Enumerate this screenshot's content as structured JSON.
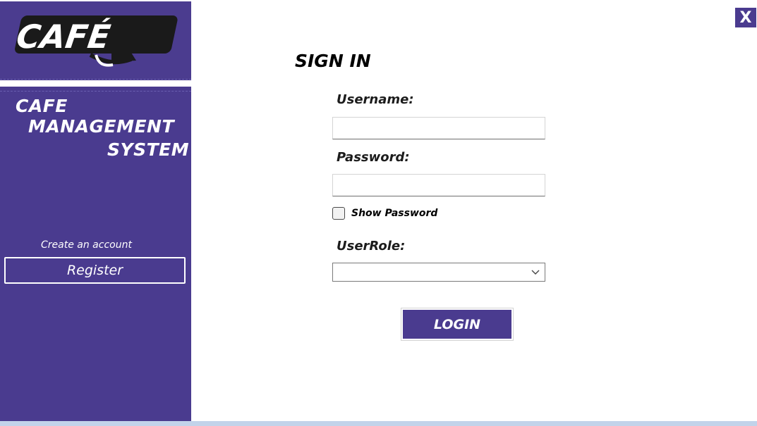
{
  "sidebar": {
    "logo_text": "CAFÉ",
    "title_lines": [
      "CAFE",
      "MANAGEMENT",
      "SYSTEM"
    ],
    "create_account_text": "Create an account",
    "register_label": "Register"
  },
  "close_button": {
    "label": "X"
  },
  "form": {
    "heading": "SIGN IN",
    "username": {
      "label": "Username:",
      "value": "",
      "placeholder": ""
    },
    "password": {
      "label": "Password:",
      "value": "",
      "placeholder": ""
    },
    "show_password": {
      "label": "Show Password",
      "checked": false
    },
    "user_role": {
      "label": "UserRole:",
      "selected": ""
    },
    "login_label": "LOGIN"
  },
  "colors": {
    "sidebar": "#4a3b8f",
    "accent": "#4a3b8f",
    "bottom_bar": "#c2d3ea"
  }
}
